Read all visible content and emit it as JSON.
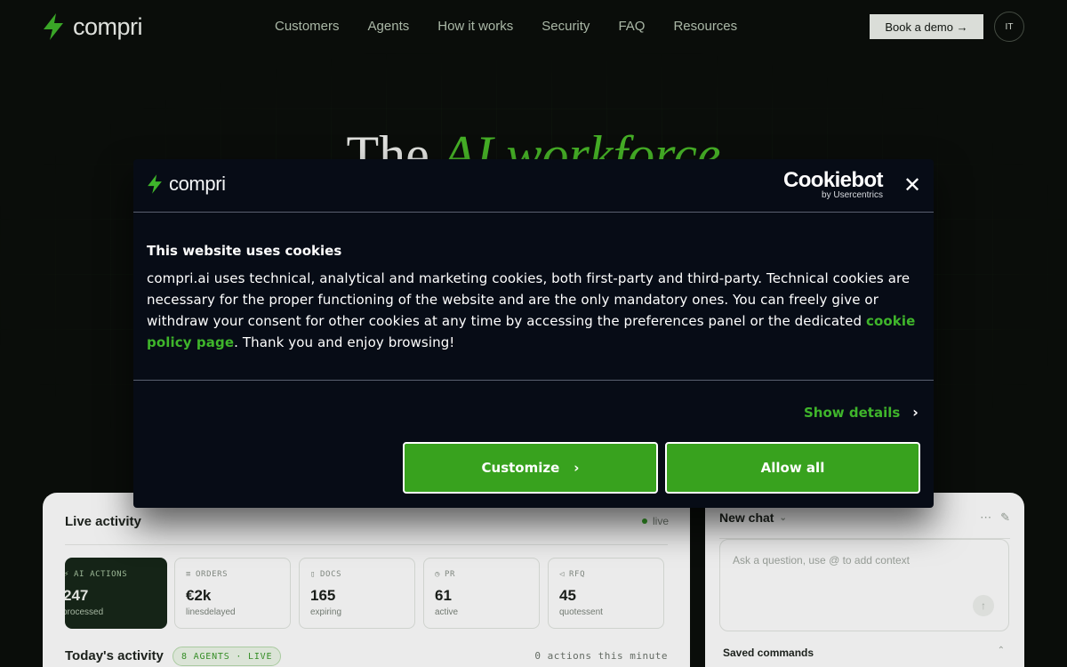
{
  "nav": {
    "logo_text": "compri",
    "menu": [
      {
        "label": "Customers"
      },
      {
        "label": "Agents"
      },
      {
        "label": "How it works"
      },
      {
        "label": "Security"
      },
      {
        "label": "FAQ"
      },
      {
        "label": "Resources"
      }
    ],
    "demo_label": "Book a demo →",
    "lang_label": "IT"
  },
  "hero": {
    "title_plain": "The ",
    "title_accent": "AI workforce"
  },
  "live_activity": {
    "title": "Live activity",
    "live_label": "live",
    "stats": [
      {
        "label": "AI ACTIONS",
        "value": "247",
        "sub": "processed"
      },
      {
        "label": "ORDERS",
        "value": "€2k",
        "sub": "linesdelayed"
      },
      {
        "label": "DOCS",
        "value": "165",
        "sub": "expiring"
      },
      {
        "label": "PR",
        "value": "61",
        "sub": "active"
      },
      {
        "label": "RFQ",
        "value": "45",
        "sub": "quotessent"
      }
    ],
    "today_title": "Today's activity",
    "agents_badge": "8 AGENTS · LIVE",
    "actions_minute": "0 actions this minute"
  },
  "chat": {
    "title": "New chat",
    "placeholder": "Ask a question, use @ to add context",
    "saved_commands": "Saved commands"
  },
  "cookie": {
    "logo_text": "compri",
    "brand_main": "Cookiebot",
    "brand_sub": "by Usercentrics",
    "heading": "This website uses cookies",
    "body_before": "compri.ai uses technical, analytical and marketing cookies, both first-party and third-party. Technical cookies are necessary for the proper functioning of the website and are the only mandatory ones. You can freely give or withdraw your consent for other cookies at any time by accessing the preferences panel or the dedicated ",
    "body_link": "cookie policy page",
    "body_after": ". Thank you and enjoy browsing!",
    "show_details": "Show details",
    "customize": "Customize",
    "allow_all": "Allow all"
  },
  "colors": {
    "accent": "#3fb52b",
    "background": "#0b0f0b",
    "modal_bg": "#070c16",
    "button_green": "#38a21e"
  },
  "icons": [
    "bolt-icon",
    "close-icon",
    "chevron-right-icon",
    "chevron-down-icon",
    "more-icon",
    "edit-icon",
    "send-icon",
    "live-dot"
  ]
}
